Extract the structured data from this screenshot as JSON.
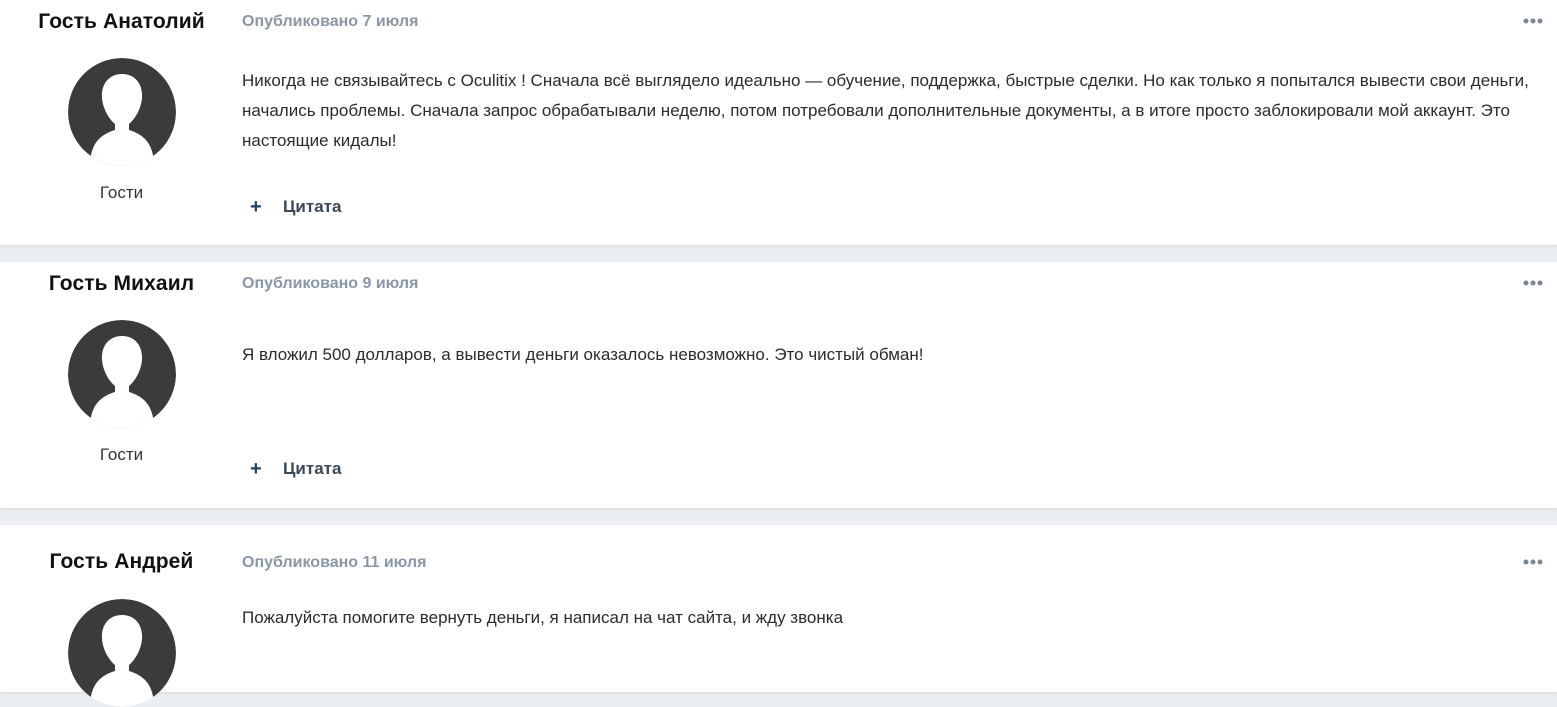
{
  "posts": [
    {
      "author": "Гость Анатолий",
      "group": "Гости",
      "date": "Опубликовано 7 июля",
      "body": "Никогда не связывайтесь с Oculitix ! Сначала всё выглядело идеально — обучение, поддержка, быстрые сделки. Но как только я попытался вывести свои деньги, начались проблемы. Сначала запрос обрабатывали неделю, потом потребовали дополнительные документы, а в итоге просто заблокировали мой аккаунт. Это настоящие кидалы!",
      "quote_label": "Цитата"
    },
    {
      "author": "Гость Михаил",
      "group": "Гости",
      "date": "Опубликовано 9 июля",
      "body": "Я вложил 500 долларов, а вывести деньги оказалось невозможно. Это чистый обман!",
      "quote_label": "Цитата"
    },
    {
      "author": "Гость Андрей",
      "date": "Опубликовано 11 июля",
      "body": "Пожалуйста помогите вернуть деньги, я написал на чат сайта, и жду звонка"
    }
  ],
  "icons": {
    "more": "ellipsis-icon",
    "avatar": "default-user-avatar",
    "quote": "plus-icon"
  },
  "colors": {
    "background": "#ebeef2",
    "card": "#ffffff",
    "date": "#8a97a6",
    "avatar": "#3b3b3b",
    "quote_plus": "#1f3f5c"
  }
}
